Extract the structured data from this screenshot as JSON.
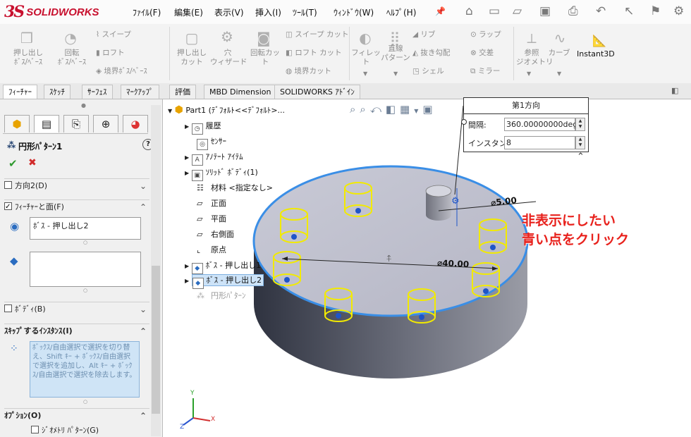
{
  "app": {
    "logo_mark": "3S",
    "logo_text": "SOLIDWORKS"
  },
  "menu": [
    "ﾌｧｲﾙ(F)",
    "編集(E)",
    "表示(V)",
    "挿入(I)",
    "ﾂｰﾙ(T)",
    "ｳｨﾝﾄﾞｳ(W)",
    "ﾍﾙﾌﾟ(H)"
  ],
  "ribbon": {
    "extrude_boss": "押し出し\nﾎﾞｽ/ﾍﾞｰｽ",
    "revolve_boss": "回転\nﾎﾞｽ/ﾍﾞｰｽ",
    "sweep": "スイープ",
    "loft": "ロフト",
    "boundary_boss": "境界ﾎﾞｽ/ﾍﾞｰｽ",
    "extrude_cut": "押し出し\nカット",
    "hole_wizard": "穴\nウィザード",
    "revolve_cut": "回転カット",
    "swept_cut": "スイープ カット",
    "lofted_cut": "ロフト カット",
    "boundary_cut": "境界カット",
    "fillet": "フィレット",
    "linear_pattern": "直線\nパターン",
    "rib": "リブ",
    "draft": "抜き勾配",
    "shell": "シェル",
    "wrap": "ラップ",
    "intersect": "交差",
    "mirror": "ミラー",
    "ref_geometry": "参照\nジオメトリ",
    "curves": "カーブ",
    "instant3d": "Instant3D"
  },
  "tabs": [
    "ﾌｨｰﾁｬｰ",
    "ｽｹｯﾁ",
    "ｻｰﾌｪｽ",
    "ﾏｰｸｱｯﾌﾟ",
    "評価",
    "MBD Dimension",
    "SOLIDWORKS ｱﾄﾞｲﾝ"
  ],
  "pm": {
    "title": "円形ﾊﾟﾀｰﾝ1",
    "help": "?",
    "ok": "✔",
    "cancel": "✖",
    "direction2": "方向2(D)",
    "features_faces": "ﾌｨｰﾁｬｰと面(F)",
    "feature_item": "ﾎﾞｽ - 押し出し2",
    "bodies": "ﾎﾞﾃﾞｨ(B)",
    "skip_instances": "ｽｷｯﾌﾟするｲﾝｽﾀﾝｽ(I)",
    "skip_help": "ﾎﾞｯｸｽ/自由選択で選択を切り替え、Shift ｷｰ + ﾎﾞｯｸｽ/自由選択で選択を追加し、Alt ｷｰ + ﾎﾞｯｸｽ/自由選択で選択を除去します。",
    "options": "ｵﾌﾟｼｮﾝ(O)",
    "geometry_pattern": "ｼﾞｵﾒﾄﾘ ﾊﾟﾀｰﾝ(G)"
  },
  "tree": {
    "root": "Part1 (ﾃﾞﾌｫﾙﾄ<<ﾃﾞﾌｫﾙﾄ>...",
    "items": [
      "履歴",
      "ｾﾝｻｰ",
      "ｱﾉﾃｰﾄ ｱｲﾃﾑ",
      "ｿﾘｯﾄﾞ ﾎﾞﾃﾞｨ(1)",
      "材料 <指定なし>",
      "正面",
      "平面",
      "右側面",
      "原点",
      "ﾎﾞｽ - 押し出し1",
      "ﾎﾞｽ - 押し出し2",
      "円形ﾊﾟﾀｰﾝ"
    ]
  },
  "callout": {
    "title": "第1方向",
    "spacing_label": "間隔:",
    "spacing_value": "360.00000000deg",
    "instances_label": "インスタンス:",
    "instances_value": "8"
  },
  "dims": {
    "small": "⌀5.00",
    "large": "⌀40.00"
  },
  "annotation": {
    "line1": "非表示にしたい",
    "line2": "青い点をクリック",
    "color": "#e8211c"
  },
  "triad": {
    "x": "X",
    "y": "Y",
    "z": "Z"
  },
  "colors": {
    "accent": "#3a8ee6",
    "yellow": "#f2ea00",
    "dot": "#1f55c8"
  }
}
